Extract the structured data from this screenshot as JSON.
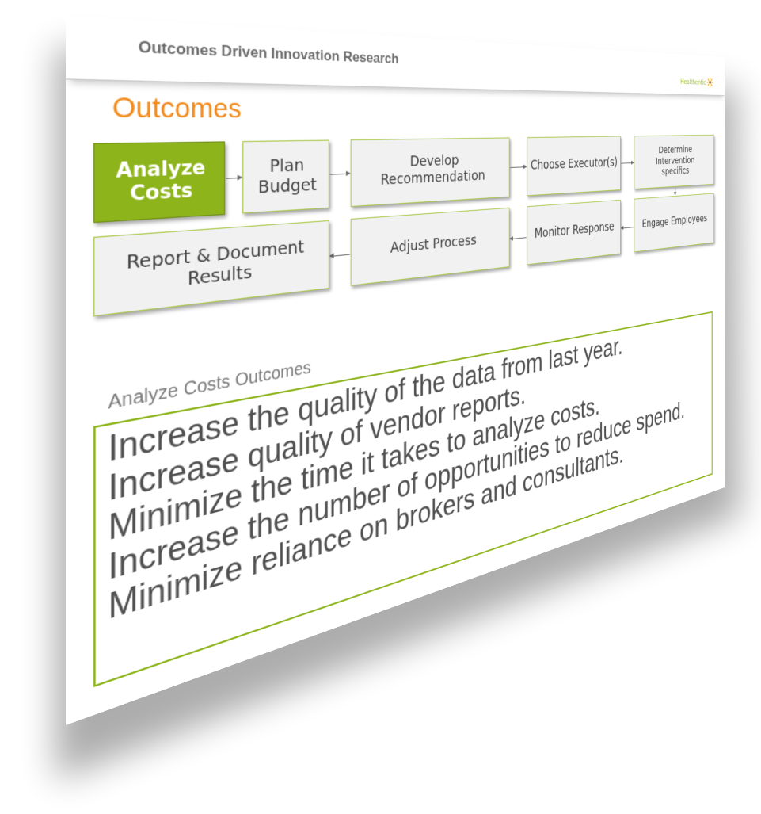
{
  "header": {
    "title": "Outcomes Driven Innovation Research",
    "logo_text": "Healthentic",
    "logo_icon": "sunflower-icon"
  },
  "page_title": "Outcomes",
  "process_flow": {
    "steps": [
      {
        "label": "Analyze Costs",
        "active": true
      },
      {
        "label": "Plan Budget",
        "active": false
      },
      {
        "label": "Develop Recommendation",
        "active": false
      },
      {
        "label": "Choose Executor(s)",
        "active": false
      },
      {
        "label": "Determine Intervention specifics",
        "active": false
      },
      {
        "label": "Engage Employees",
        "active": false
      },
      {
        "label": "Monitor Response",
        "active": false
      },
      {
        "label": "Adjust Process",
        "active": false
      },
      {
        "label": "Report & Document Results",
        "active": false
      }
    ],
    "colors": {
      "active_fill": "#8db41b",
      "box_border": "#a9c84a",
      "box_fill": "#f1f1f1",
      "title_orange": "#f28a1b"
    }
  },
  "outcomes": {
    "section_label": "Analyze Costs Outcomes",
    "items": [
      "Increase the quality of the data from last year.",
      "Increase quality of vendor reports.",
      "Minimize the time it takes to analyze costs.",
      "Increase the number of opportunities to reduce spend.",
      "Minimize reliance on brokers and consultants."
    ]
  }
}
